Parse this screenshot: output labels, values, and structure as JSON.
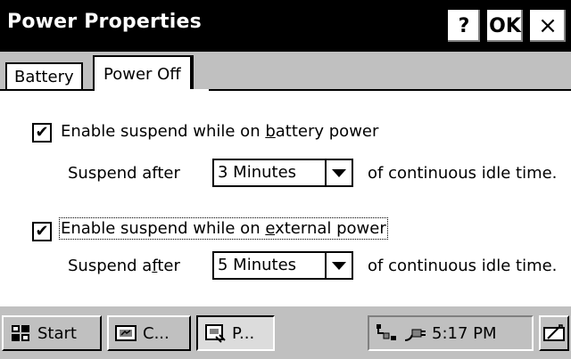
{
  "window": {
    "title": "Power Properties",
    "help_label": "?",
    "ok_label": "OK",
    "close_label": "×"
  },
  "tabs": [
    {
      "label": "Battery",
      "selected": false
    },
    {
      "label": "Power Off",
      "selected": true
    }
  ],
  "battery_section": {
    "checkbox_label_pre": "Enable suspend while on ",
    "checkbox_label_key": "b",
    "checkbox_label_post": "attery power",
    "checked": true,
    "suspend_after_label": "Suspend after",
    "timeout_value": "3 Minutes",
    "suffix": "of continuous idle time."
  },
  "external_section": {
    "checkbox_label_pre": "Enable suspend while on ",
    "checkbox_label_key": "e",
    "checkbox_label_post": "xternal power",
    "checked": true,
    "suspend_after_pre": "Suspend a",
    "suspend_after_key": "f",
    "suspend_after_post": "ter",
    "timeout_value": "5 Minutes",
    "suffix": "of continuous idle time."
  },
  "taskbar": {
    "start_label": "Start",
    "task1_label": "C...",
    "task2_label": "P...",
    "clock": "5:17 PM"
  },
  "icons": {
    "start": "windows-flag-icon",
    "task1": "control-panel-icon",
    "task2": "power-properties-icon",
    "tray1": "network-connection-icon",
    "tray2": "ac-power-plug-icon",
    "input": "input-panel-icon"
  }
}
